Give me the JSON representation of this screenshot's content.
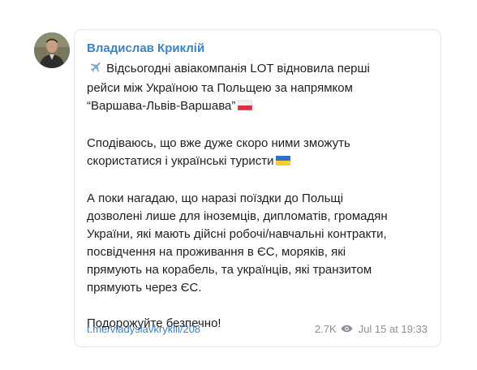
{
  "post": {
    "author": "Владислав Криклій",
    "paragraphs": [
      {
        "lines": [
          "Відсьогодні авіакомпанія LOT відновила перші",
          "рейси між Україною та Польщею за напрямком",
          "“Варшава-Львів-Варшава”"
        ]
      },
      {
        "lines": [
          "Сподіваюсь, що вже дуже скоро ними зможуть",
          "скористатися і українські туристи"
        ]
      },
      {
        "lines": [
          "А поки нагадаю, що наразі поїздки до Польщі",
          "дозволені лише для іноземців, дипломатів, громадян",
          "України, які мають дійсні робочі/навчальні контракти,",
          "посвідчення на проживання в ЄС, моряків, які",
          "прямують на корабель, та українців, які транзитом",
          "прямують через ЄС."
        ]
      },
      {
        "lines": [
          "Подорожуйте безпечно!"
        ]
      }
    ],
    "icons": {
      "airplane": "airplane-icon",
      "poland_flag": "poland-flag-icon",
      "ukraine_flag": "ukraine-flag-icon",
      "views": "eye-icon"
    },
    "link": "t.me/vladyslavkryklii/208",
    "views": "2.7K",
    "timestamp": "Jul 15 at 19:33",
    "colors": {
      "accent": "#3a83c7",
      "text": "#1f1f1f",
      "muted": "#8a9099",
      "border": "#e3e6ea"
    }
  }
}
